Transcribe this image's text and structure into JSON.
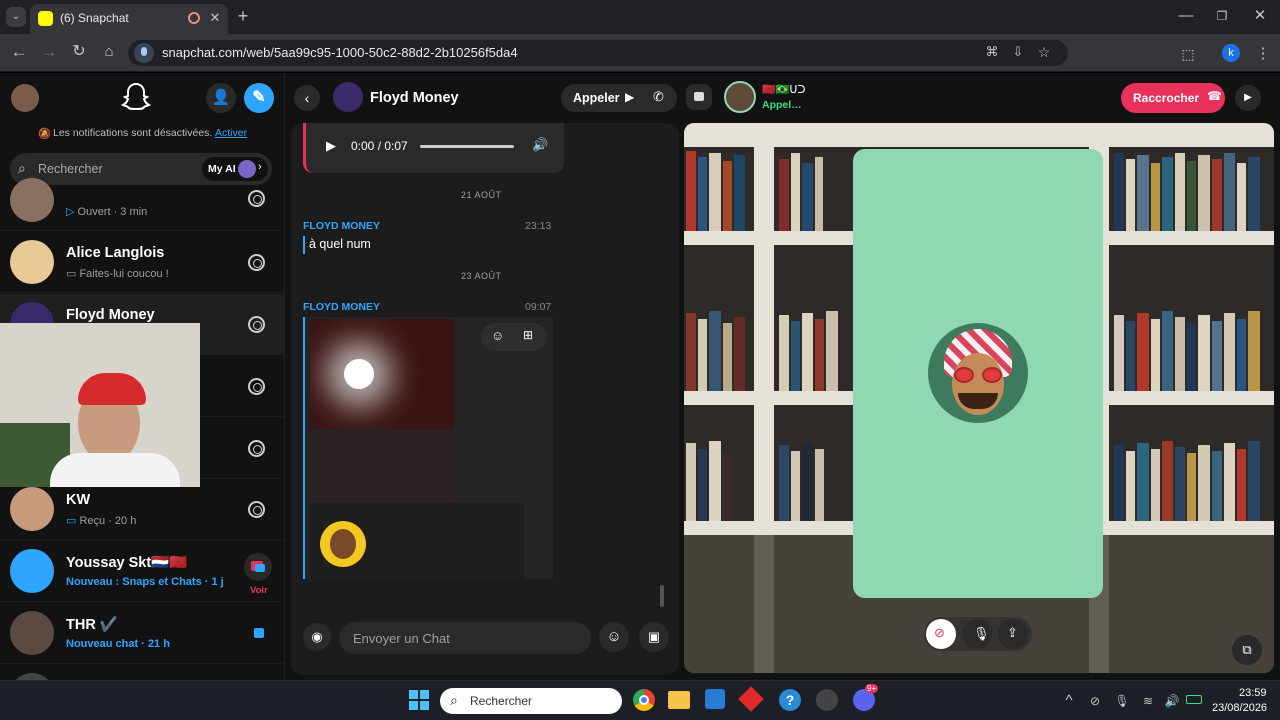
{
  "browser": {
    "tab_title": "(6) Snapchat",
    "url": "snapchat.com/web/5aa99c95-1000-50c2-88d2-2b10256f5da4",
    "profile_initial": "k"
  },
  "sidebar": {
    "notif_text": "Les notifications sont désactivées.",
    "notif_action": "Activer",
    "search_placeholder": "Rechercher",
    "myai_label": "My AI",
    "contacts": [
      {
        "name": "",
        "status": "Ouvert · 3 min"
      },
      {
        "name": "Alice Langlois",
        "status": "Faites-lui coucou !"
      },
      {
        "name": "Floyd Money",
        "status": ""
      },
      {
        "name": "KW",
        "status": "Reçu · 20 h"
      },
      {
        "name": "Youssay Skt🇳🇱🇲🇦",
        "status": "Nouveau : Snaps et Chats · 1 j",
        "action": "Voir"
      },
      {
        "name": "THR ✔️",
        "status": "Nouveau chat · 21 h"
      }
    ]
  },
  "chat": {
    "contact_name": "Floyd Money",
    "call_label": "Appeler",
    "audio_time": "0:00 / 0:07",
    "date1": "21 AOÛT",
    "sender1": "FLOYD MONEY",
    "time1": "23:13",
    "message1": "à quel num",
    "date2": "23 AOÛT",
    "sender2": "FLOYD MONEY",
    "time2": "09:07",
    "input_placeholder": "Envoyer un Chat"
  },
  "call": {
    "caller_flags": "🇲🇦🇧🇷ᑌᑐ",
    "caller_status": "Appel…",
    "hangup_label": "Raccrocher"
  },
  "taskbar": {
    "search_label": "Rechercher",
    "time": "23:59",
    "date": "23/08/2026",
    "discord_badge": "9+"
  },
  "colors": {
    "accent_blue": "#2ea6ff",
    "hangup_red": "#e8315b",
    "avatar_bg": "#8fd8b4"
  }
}
